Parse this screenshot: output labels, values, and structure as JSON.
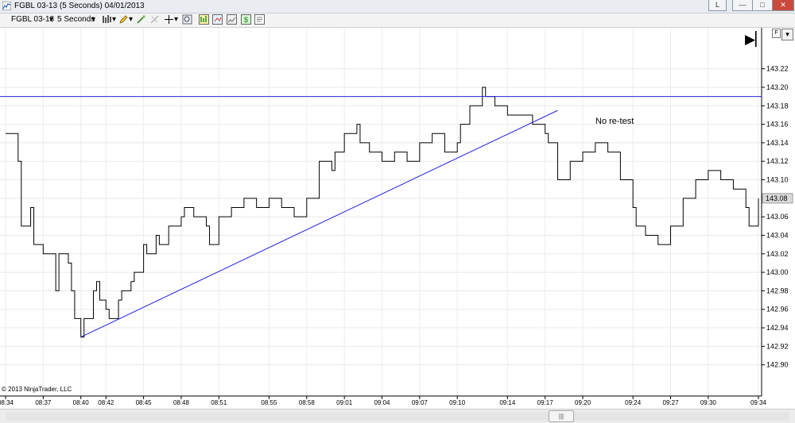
{
  "window": {
    "title": "FGBL 03-13 (5 Seconds)  04/01/2013",
    "buttons": {
      "help": "L",
      "minimize": "—",
      "maximize": "□",
      "close": "✕"
    }
  },
  "toolbar": {
    "instrument": "FGBL 03-13",
    "interval": "5 Seconds"
  },
  "panel_buttons": {
    "f": "F",
    "menu": "▾",
    "scroll_to_end": "▶▏"
  },
  "annotation": "No re-test",
  "copyright": "© 2013 NinjaTrader, LLC",
  "scrollbar": {
    "thumb": "|||"
  },
  "colors": {
    "price_line": "#000000",
    "trend_line": "#2222dd",
    "horizontal_line": "#2222dd",
    "current_price_box": "#d9d9d9"
  },
  "chart_data": {
    "type": "line",
    "ylim": [
      142.88,
      143.23
    ],
    "yticks": [
      "143.22",
      "143.20",
      "143.18",
      "143.16",
      "143.14",
      "143.12",
      "143.10",
      "143.08",
      "143.06",
      "143.04",
      "143.02",
      "143.00",
      "142.98",
      "142.96",
      "142.94",
      "142.92",
      "142.90"
    ],
    "xticks": [
      "08:34",
      "08:37",
      "08:40",
      "08:42",
      "08:45",
      "08:48",
      "08:51",
      "08:55",
      "08:58",
      "09:01",
      "09:04",
      "09:07",
      "09:10",
      "09:14",
      "09:17",
      "09:20",
      "09:24",
      "09:27",
      "09:30",
      "09:34"
    ],
    "current_price": "143.08",
    "horizontal_line": 143.19,
    "trend_line": {
      "from": [
        "08:40",
        142.93
      ],
      "to": [
        "09:18",
        143.175
      ]
    },
    "price_series": [
      [
        "08:34",
        143.15
      ],
      [
        "08:35",
        143.12
      ],
      [
        "08:35",
        143.05
      ],
      [
        "08:36",
        143.07
      ],
      [
        "08:36",
        143.03
      ],
      [
        "08:37",
        143.02
      ],
      [
        "08:38",
        142.98
      ],
      [
        "08:38",
        143.02
      ],
      [
        "08:39",
        143.01
      ],
      [
        "08:39",
        142.98
      ],
      [
        "08:39",
        142.95
      ],
      [
        "08:40",
        142.93
      ],
      [
        "08:40",
        142.95
      ],
      [
        "08:41",
        142.98
      ],
      [
        "08:41",
        142.99
      ],
      [
        "08:41",
        142.97
      ],
      [
        "08:42",
        142.96
      ],
      [
        "08:42",
        142.95
      ],
      [
        "08:43",
        142.97
      ],
      [
        "08:43",
        142.98
      ],
      [
        "08:44",
        142.99
      ],
      [
        "08:44",
        143.0
      ],
      [
        "08:45",
        143.03
      ],
      [
        "08:45",
        143.02
      ],
      [
        "08:46",
        143.04
      ],
      [
        "08:46",
        143.03
      ],
      [
        "08:47",
        143.05
      ],
      [
        "08:48",
        143.06
      ],
      [
        "08:48",
        143.07
      ],
      [
        "08:49",
        143.06
      ],
      [
        "08:50",
        143.05
      ],
      [
        "08:50",
        143.03
      ],
      [
        "08:51",
        143.06
      ],
      [
        "08:52",
        143.07
      ],
      [
        "08:53",
        143.08
      ],
      [
        "08:54",
        143.07
      ],
      [
        "08:55",
        143.08
      ],
      [
        "08:56",
        143.07
      ],
      [
        "08:57",
        143.06
      ],
      [
        "08:58",
        143.08
      ],
      [
        "08:59",
        143.12
      ],
      [
        "09:00",
        143.11
      ],
      [
        "09:00",
        143.13
      ],
      [
        "09:01",
        143.15
      ],
      [
        "09:02",
        143.16
      ],
      [
        "09:02",
        143.14
      ],
      [
        "09:03",
        143.13
      ],
      [
        "09:04",
        143.12
      ],
      [
        "09:05",
        143.13
      ],
      [
        "09:06",
        143.12
      ],
      [
        "09:07",
        143.14
      ],
      [
        "09:08",
        143.15
      ],
      [
        "09:09",
        143.13
      ],
      [
        "09:10",
        143.14
      ],
      [
        "09:10",
        143.16
      ],
      [
        "09:11",
        143.18
      ],
      [
        "09:12",
        143.2
      ],
      [
        "09:12",
        143.19
      ],
      [
        "09:13",
        143.18
      ],
      [
        "09:14",
        143.17
      ],
      [
        "09:15",
        143.17
      ],
      [
        "09:16",
        143.16
      ],
      [
        "09:17",
        143.15
      ],
      [
        "09:17",
        143.14
      ],
      [
        "09:18",
        143.1
      ],
      [
        "09:19",
        143.12
      ],
      [
        "09:20",
        143.13
      ],
      [
        "09:21",
        143.14
      ],
      [
        "09:22",
        143.13
      ],
      [
        "09:23",
        143.1
      ],
      [
        "09:24",
        143.07
      ],
      [
        "09:24",
        143.05
      ],
      [
        "09:25",
        143.04
      ],
      [
        "09:26",
        143.03
      ],
      [
        "09:27",
        143.05
      ],
      [
        "09:28",
        143.08
      ],
      [
        "09:29",
        143.1
      ],
      [
        "09:30",
        143.11
      ],
      [
        "09:31",
        143.1
      ],
      [
        "09:32",
        143.09
      ],
      [
        "09:33",
        143.07
      ],
      [
        "09:33",
        143.05
      ],
      [
        "09:34",
        143.08
      ]
    ]
  }
}
